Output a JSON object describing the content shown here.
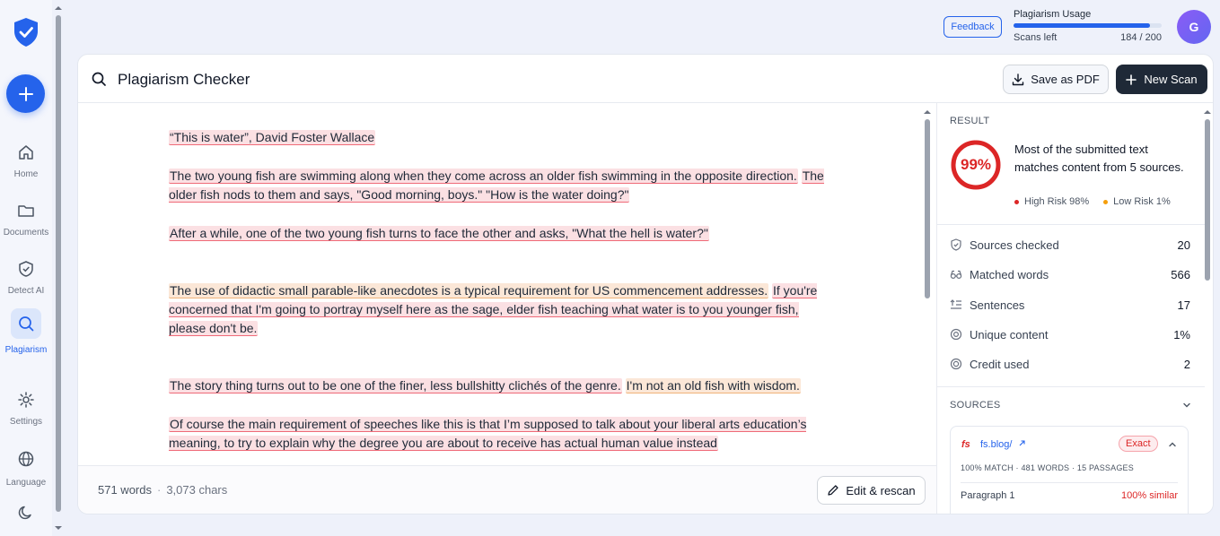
{
  "sidebar": {
    "items": [
      {
        "label": "Home",
        "icon": "home-icon"
      },
      {
        "label": "Documents",
        "icon": "folder-icon"
      },
      {
        "label": "Detect AI",
        "icon": "shield-icon"
      },
      {
        "label": "Plagiarism",
        "icon": "search-icon"
      },
      {
        "label": "Settings",
        "icon": "gear-icon"
      },
      {
        "label": "Language",
        "icon": "globe-icon"
      }
    ]
  },
  "header": {
    "feedback_label": "Feedback",
    "usage_title": "Plagiarism Usage",
    "scans_left_label": "Scans left",
    "scans_count": "184 / 200",
    "usage_fraction": 0.92,
    "avatar_initial": "G"
  },
  "main": {
    "title": "Plagiarism Checker",
    "save_pdf_label": "Save as PDF",
    "new_scan_label": "New Scan",
    "word_count": "571 words",
    "char_count": "3,073 chars",
    "edit_rescan_label": "Edit & rescan",
    "paragraphs": [
      [
        {
          "t": "“This is water”, David Foster Wallace",
          "h": "red"
        }
      ],
      [
        {
          "t": "The two young fish are swimming along when they come across an older fish swimming in the opposite direction.",
          "h": "red"
        },
        {
          "t": " ",
          "h": ""
        },
        {
          "t": "The older fish nods to them and says, \"Good morning, boys.\" \"How is the water doing?\"",
          "h": "red"
        }
      ],
      [
        {
          "t": "After a while, one of the two young fish turns to face the other and asks, \"What the hell is water?\"",
          "h": "red"
        }
      ],
      [
        {
          "t": "The use of didactic small parable-like anecdotes is a typical requirement for US commencement addresses.",
          "h": "orange"
        },
        {
          "t": " ",
          "h": ""
        },
        {
          "t": "If you're concerned that I'm going to portray myself here as the sage, elder fish teaching what water is to you younger fish, please don't be.",
          "h": "red"
        }
      ],
      [
        {
          "t": "The story thing turns out to be one of the finer, less bullshitty clichés of the genre.",
          "h": "red"
        },
        {
          "t": " ",
          "h": ""
        },
        {
          "t": "I'm not an old fish with wisdom.",
          "h": "orange"
        }
      ],
      [
        {
          "t": "Of course the main requirement of speeches like this is that I’m supposed to talk about your liberal arts education’s meaning, to try to explain why the degree you are about to receive has actual human value instead",
          "h": "red"
        }
      ]
    ]
  },
  "result": {
    "label": "RESULT",
    "percent": "99%",
    "percent_value": 99,
    "summary": "Most of the submitted text matches content from 5 sources.",
    "high_risk": "High Risk 98%",
    "low_risk": "Low Risk 1%",
    "colors": {
      "high": "#dc2626",
      "low": "#f59e0b"
    }
  },
  "stats": [
    {
      "label": "Sources checked",
      "value": "20",
      "icon": "shield-check-icon"
    },
    {
      "label": "Matched words",
      "value": "566",
      "icon": "glasses-icon"
    },
    {
      "label": "Sentences",
      "value": "17",
      "icon": "text-lines-icon"
    },
    {
      "label": "Unique content",
      "value": "1%",
      "icon": "target-icon"
    },
    {
      "label": "Credit used",
      "value": "2",
      "icon": "coin-icon"
    }
  ],
  "sources": {
    "label": "SOURCES",
    "items": [
      {
        "favicon": "fs",
        "domain": "fs.blog/",
        "badge": "Exact",
        "meta": "100% MATCH · 481 WORDS · 15 PASSAGES",
        "paragraph": "Paragraph 1",
        "similarity": "100% similar"
      }
    ]
  }
}
